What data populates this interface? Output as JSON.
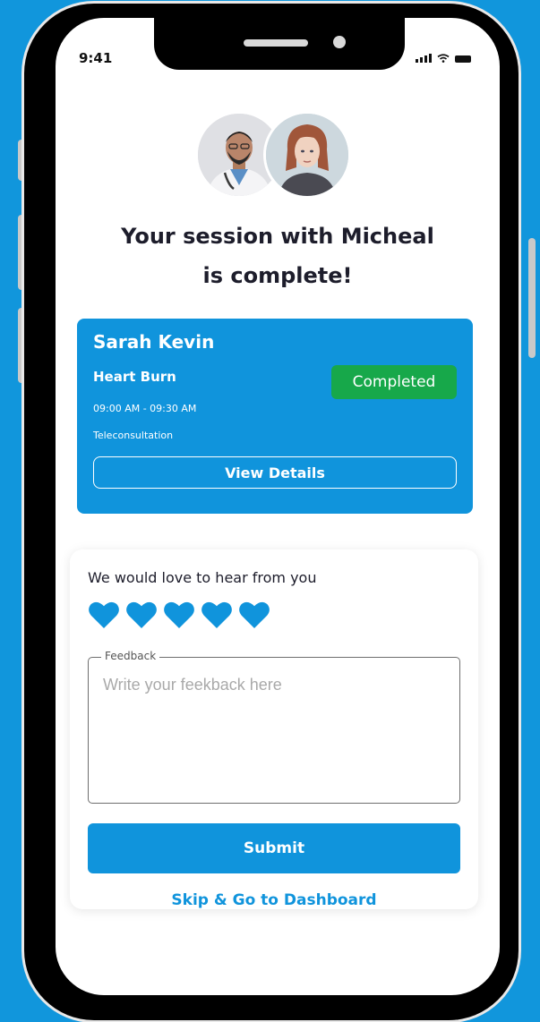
{
  "status_bar": {
    "time": "9:41"
  },
  "header": {
    "title_line1": "Your session with Micheal",
    "title_line2": "is complete!"
  },
  "avatars": [
    {
      "icon": "doctor-avatar"
    },
    {
      "icon": "patient-avatar"
    }
  ],
  "session": {
    "patient_name": "Sarah Kevin",
    "reason": "Heart Burn",
    "status": "Completed",
    "time_range": "09:00 AM - 09:30 AM",
    "type": "Teleconsultation",
    "view_details_label": "View Details"
  },
  "feedback": {
    "question": "We would love to hear from you",
    "rating": 5,
    "rating_max": 5,
    "field_label": "Feedback",
    "placeholder": "Write your feekback here",
    "submit_label": "Submit",
    "skip_label": "Skip & Go to Dashboard"
  },
  "colors": {
    "background": "#1196dc",
    "primary": "#1094dc",
    "success": "#17a84a"
  }
}
